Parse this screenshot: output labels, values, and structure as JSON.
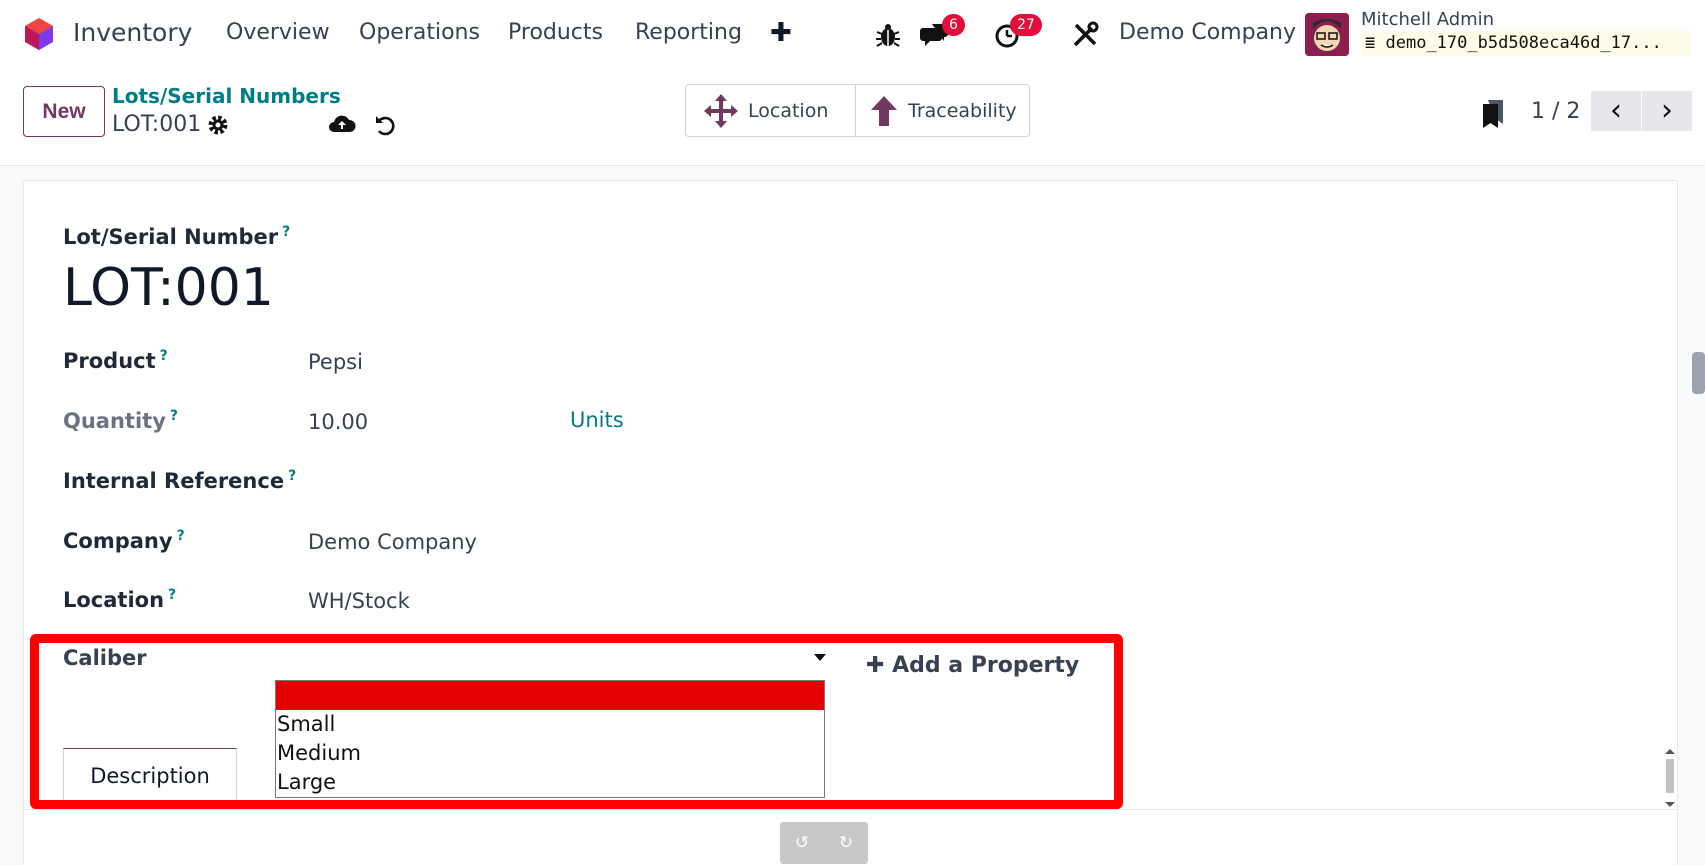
{
  "app": {
    "name": "Inventory",
    "menu": [
      "Overview",
      "Operations",
      "Products",
      "Reporting"
    ]
  },
  "systray": {
    "messages_badge": "6",
    "activities_badge": "27",
    "company": "Demo Company",
    "user_name": "Mitchell Admin",
    "database": "demo_170_b5d508eca46d_17..."
  },
  "control_panel": {
    "new_label": "New",
    "breadcrumb": "Lots/Serial Numbers",
    "record": "LOT:001",
    "smart_buttons": {
      "location": "Location",
      "traceability": "Traceability"
    },
    "pager": "1 / 2"
  },
  "form": {
    "title_label": "Lot/Serial Number",
    "title_help": "?",
    "title_value": "LOT:001",
    "fields": {
      "product": {
        "label": "Product",
        "value": "Pepsi"
      },
      "quantity": {
        "label": "Quantity",
        "value": "10.00",
        "unit": "Units"
      },
      "internal_ref": {
        "label": "Internal Reference",
        "value": ""
      },
      "company": {
        "label": "Company",
        "value": "Demo Company"
      },
      "location": {
        "label": "Location",
        "value": "WH/Stock"
      }
    },
    "property": {
      "label": "Caliber",
      "add_label": "Add a Property",
      "options": [
        "",
        "Small",
        "Medium",
        "Large"
      ]
    },
    "tabs": [
      "Description"
    ]
  },
  "colors": {
    "brand": "#71395f",
    "link": "#017e84",
    "badge": "#e30d3a",
    "highlight": "#ff0000"
  }
}
